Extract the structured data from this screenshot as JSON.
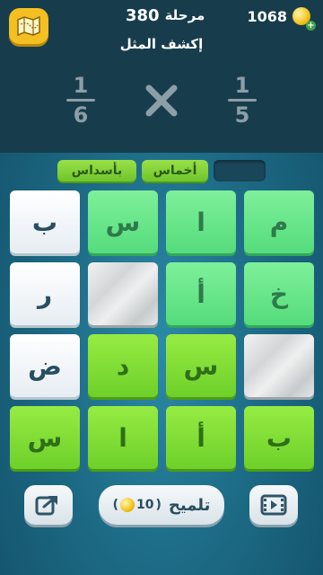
{
  "header": {
    "coins": "1068",
    "level_label": "مرحلة",
    "level_number": "380",
    "title": "إكشف المثل"
  },
  "puzzle": {
    "right_fraction": {
      "numerator": "1",
      "denominator": "5"
    },
    "left_fraction": {
      "numerator": "1",
      "denominator": "6"
    },
    "operator_icon": "multiply-icon"
  },
  "found_words": [
    {
      "text": "أخماس"
    },
    {
      "text": "بأسداس"
    }
  ],
  "board": {
    "rows": [
      [
        {
          "letter": "م",
          "style": "mint"
        },
        {
          "letter": "ا",
          "style": "mint"
        },
        {
          "letter": "س",
          "style": "mint"
        },
        {
          "letter": "ب",
          "style": "white"
        }
      ],
      [
        {
          "letter": "خ",
          "style": "mint"
        },
        {
          "letter": "أ",
          "style": "mint"
        },
        {
          "letter": "",
          "style": "stone"
        },
        {
          "letter": "ر",
          "style": "white"
        }
      ],
      [
        {
          "letter": "",
          "style": "stone"
        },
        {
          "letter": "س",
          "style": "lime"
        },
        {
          "letter": "د",
          "style": "lime"
        },
        {
          "letter": "ض",
          "style": "white"
        }
      ],
      [
        {
          "letter": "ب",
          "style": "lime"
        },
        {
          "letter": "أ",
          "style": "lime"
        },
        {
          "letter": "ا",
          "style": "lime"
        },
        {
          "letter": "س",
          "style": "lime"
        }
      ]
    ]
  },
  "footer": {
    "hint_label": "تلميح",
    "hint_cost": "10",
    "video_icon": "film-icon",
    "share_icon": "share-icon"
  },
  "colors": {
    "accent_gold": "#f4bf21",
    "tile_mint": "#55dc7c",
    "tile_lime": "#6ed02a"
  }
}
